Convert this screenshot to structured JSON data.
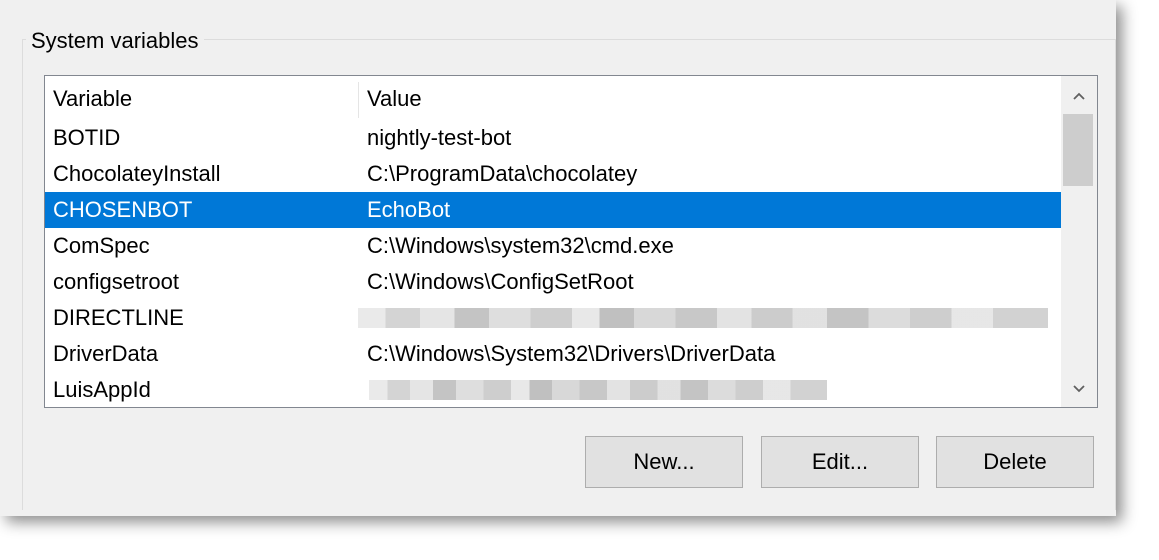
{
  "group": {
    "title": "System variables"
  },
  "table": {
    "columns": [
      "Variable",
      "Value"
    ],
    "rows": [
      {
        "name": "BOTID",
        "value": "nightly-test-bot"
      },
      {
        "name": "ChocolateyInstall",
        "value": "C:\\ProgramData\\chocolatey"
      },
      {
        "name": "CHOSENBOT",
        "value": "EchoBot"
      },
      {
        "name": "ComSpec",
        "value": "C:\\Windows\\system32\\cmd.exe"
      },
      {
        "name": "configsetroot",
        "value": "C:\\Windows\\ConfigSetRoot"
      },
      {
        "name": "DIRECTLINE",
        "value": ""
      },
      {
        "name": "DriverData",
        "value": "C:\\Windows\\System32\\Drivers\\DriverData"
      },
      {
        "name": "LuisAppId",
        "value": ""
      }
    ],
    "selected_row": "CHOSENBOT"
  },
  "buttons": {
    "new": "New...",
    "edit": "Edit...",
    "delete": "Delete"
  },
  "icons": {
    "scroll_up": "chevron-up-icon",
    "scroll_down": "chevron-down-icon"
  },
  "colors": {
    "selection": "#0078d7",
    "panel": "#f0f0f0"
  }
}
